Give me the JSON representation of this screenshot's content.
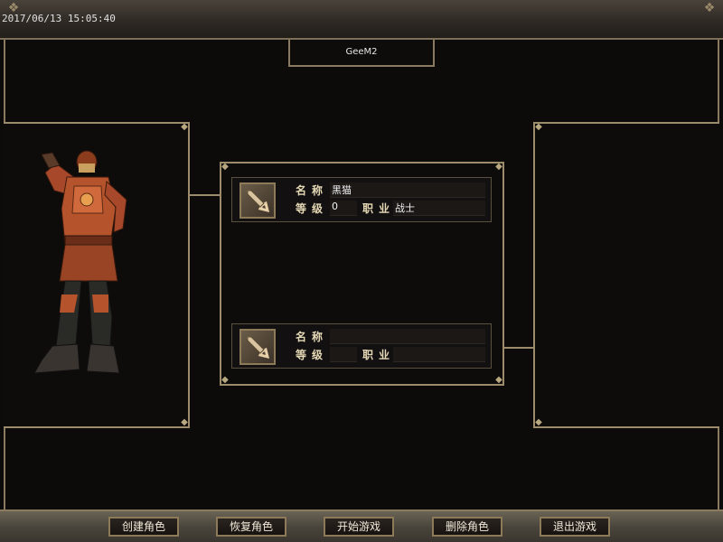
{
  "datetime": "2017/06/13 15:05:40",
  "server_name": "GeeM2",
  "slots": [
    {
      "name_label": "名称",
      "name_value": "黑猫",
      "level_label": "等级",
      "level_value": "0",
      "class_label": "职业",
      "class_value": "战士",
      "icon": "sword-icon"
    },
    {
      "name_label": "名称",
      "name_value": "",
      "level_label": "等级",
      "level_value": "",
      "class_label": "职业",
      "class_value": "",
      "icon": "sword-icon"
    }
  ],
  "buttons": {
    "create": "创建角色",
    "restore": "恢复角色",
    "start": "开始游戏",
    "delete": "删除角色",
    "exit": "退出游戏"
  },
  "colors": {
    "border": "#9c8c6c",
    "background": "#0d0a0a",
    "armor": "#b4532c"
  }
}
